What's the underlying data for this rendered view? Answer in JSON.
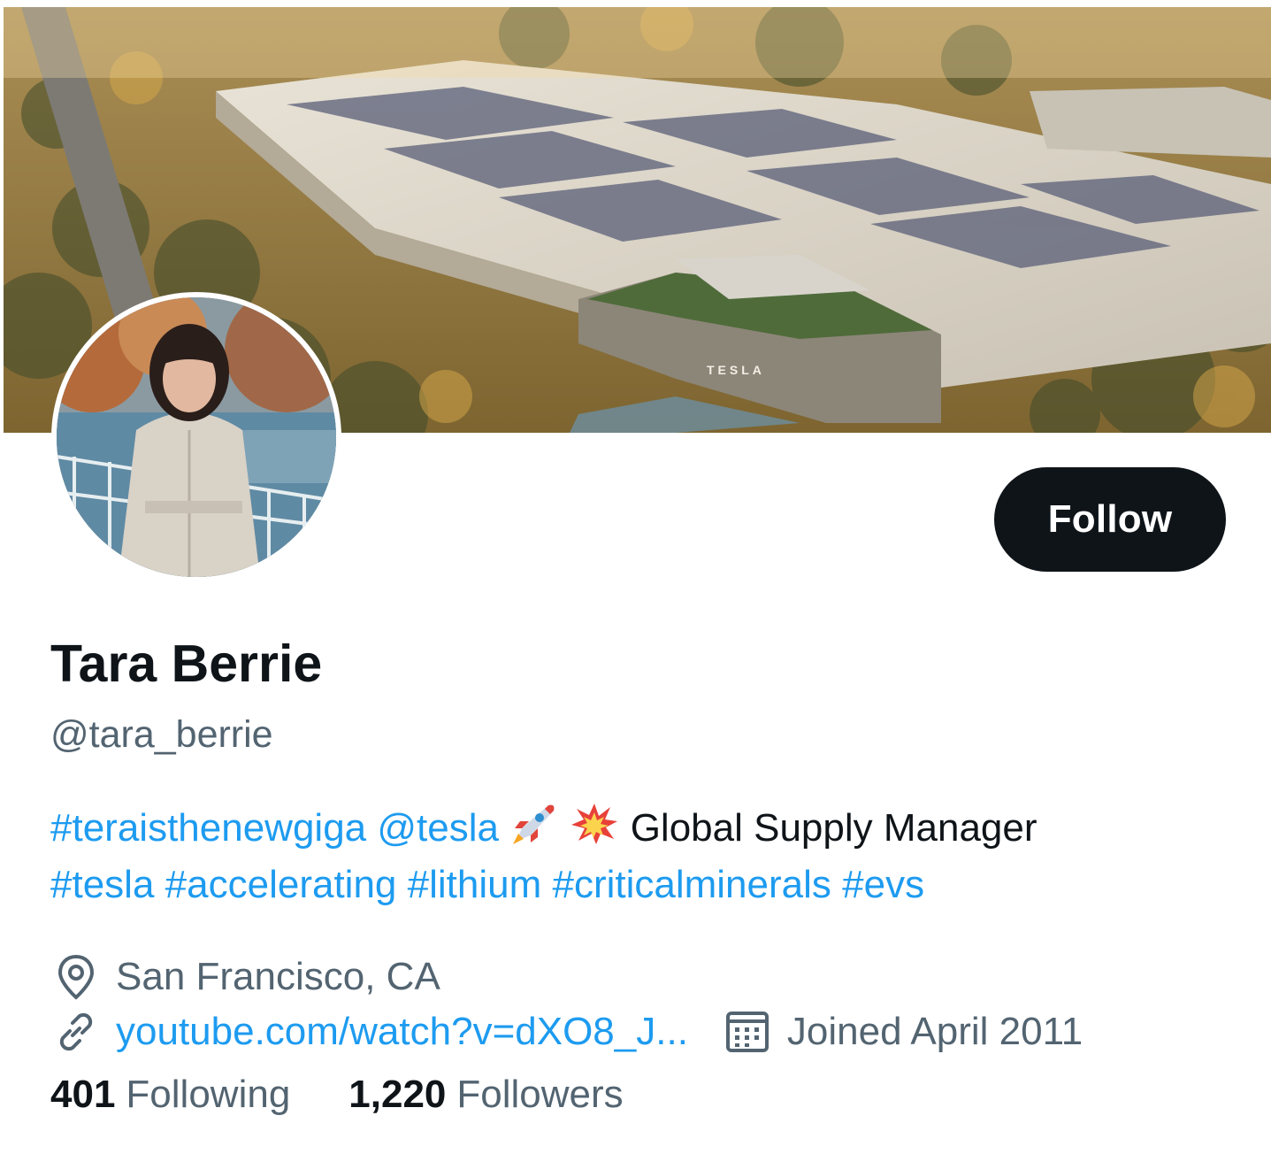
{
  "profile": {
    "display_name": "Tara Berrie",
    "handle": "@tara_berrie",
    "follow_label": "Follow",
    "banner_sign": "TESLA"
  },
  "bio": {
    "line1": {
      "hashtag1": "#teraisthenewgiga",
      "mention": "@tesla",
      "emoji1": "rocket-emoji",
      "emoji2": "collision-emoji",
      "text": "Global Supply Manager"
    },
    "line2": {
      "tags": [
        "#tesla",
        "#accelerating",
        "#lithium",
        "#criticalminerals",
        "#evs"
      ]
    }
  },
  "meta": {
    "location_icon": "location-pin-icon",
    "location": "San Francisco, CA",
    "link_icon": "link-icon",
    "url": "youtube.com/watch?v=dXO8_J...",
    "calendar_icon": "calendar-icon",
    "joined": "Joined April 2011"
  },
  "stats": {
    "following_count": "401",
    "following_label": "Following",
    "followers_count": "1,220",
    "followers_label": "Followers"
  },
  "colors": {
    "link": "#1d9bf0",
    "secondary_text": "#536471",
    "primary_text": "#0f1419",
    "button_bg": "#0f1419"
  }
}
